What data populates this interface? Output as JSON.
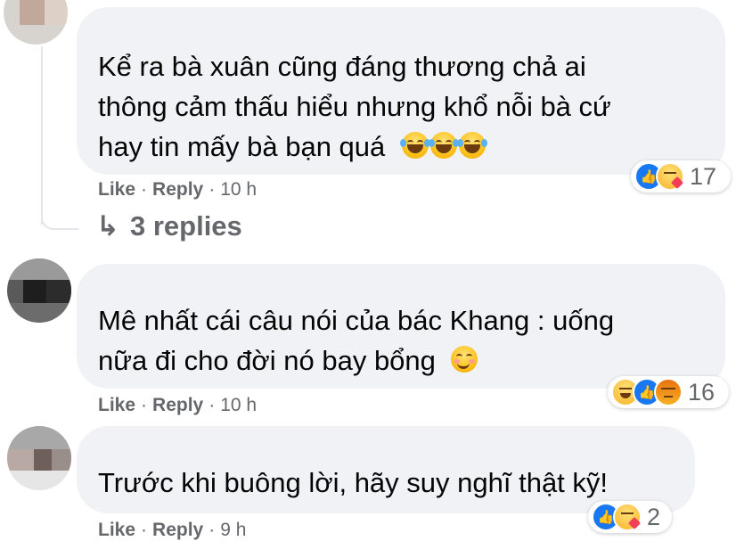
{
  "comments": [
    {
      "text_lines": [
        "Kể ra bà xuân cũng đáng thương chả ai",
        "thông cảm thấu hiểu nhưng khổ nỗi bà cứ",
        "hay tin mấy bà bạn quá"
      ],
      "reaction_count": "17",
      "like_label": "Like",
      "reply_label": "Reply",
      "time": "10 h"
    },
    {
      "text_lines": [
        "Mê nhất cái câu nói của bác Khang : uống",
        "nữa đi cho đời nó bay bổng"
      ],
      "reaction_count": "16",
      "like_label": "Like",
      "reply_label": "Reply",
      "time": "10 h"
    },
    {
      "text_lines": [
        "Trước khi buông lời, hãy suy nghĩ thật kỹ!"
      ],
      "reaction_count": "2",
      "like_label": "Like",
      "reply_label": "Reply",
      "time": "9 h"
    }
  ],
  "replies": {
    "arrow": "↳",
    "label": "3 replies"
  },
  "separator": "·",
  "icons": {
    "reaction1": [
      "like",
      "care"
    ],
    "reaction2": [
      "haha",
      "like",
      "angry"
    ],
    "reaction3": [
      "like",
      "care"
    ],
    "emoji1": "laughing-crying",
    "emoji2": "smiling-blush"
  },
  "colors": {
    "bubble": "#f0f2f5",
    "meta": "#65676b",
    "like_blue": "#1877f2"
  }
}
